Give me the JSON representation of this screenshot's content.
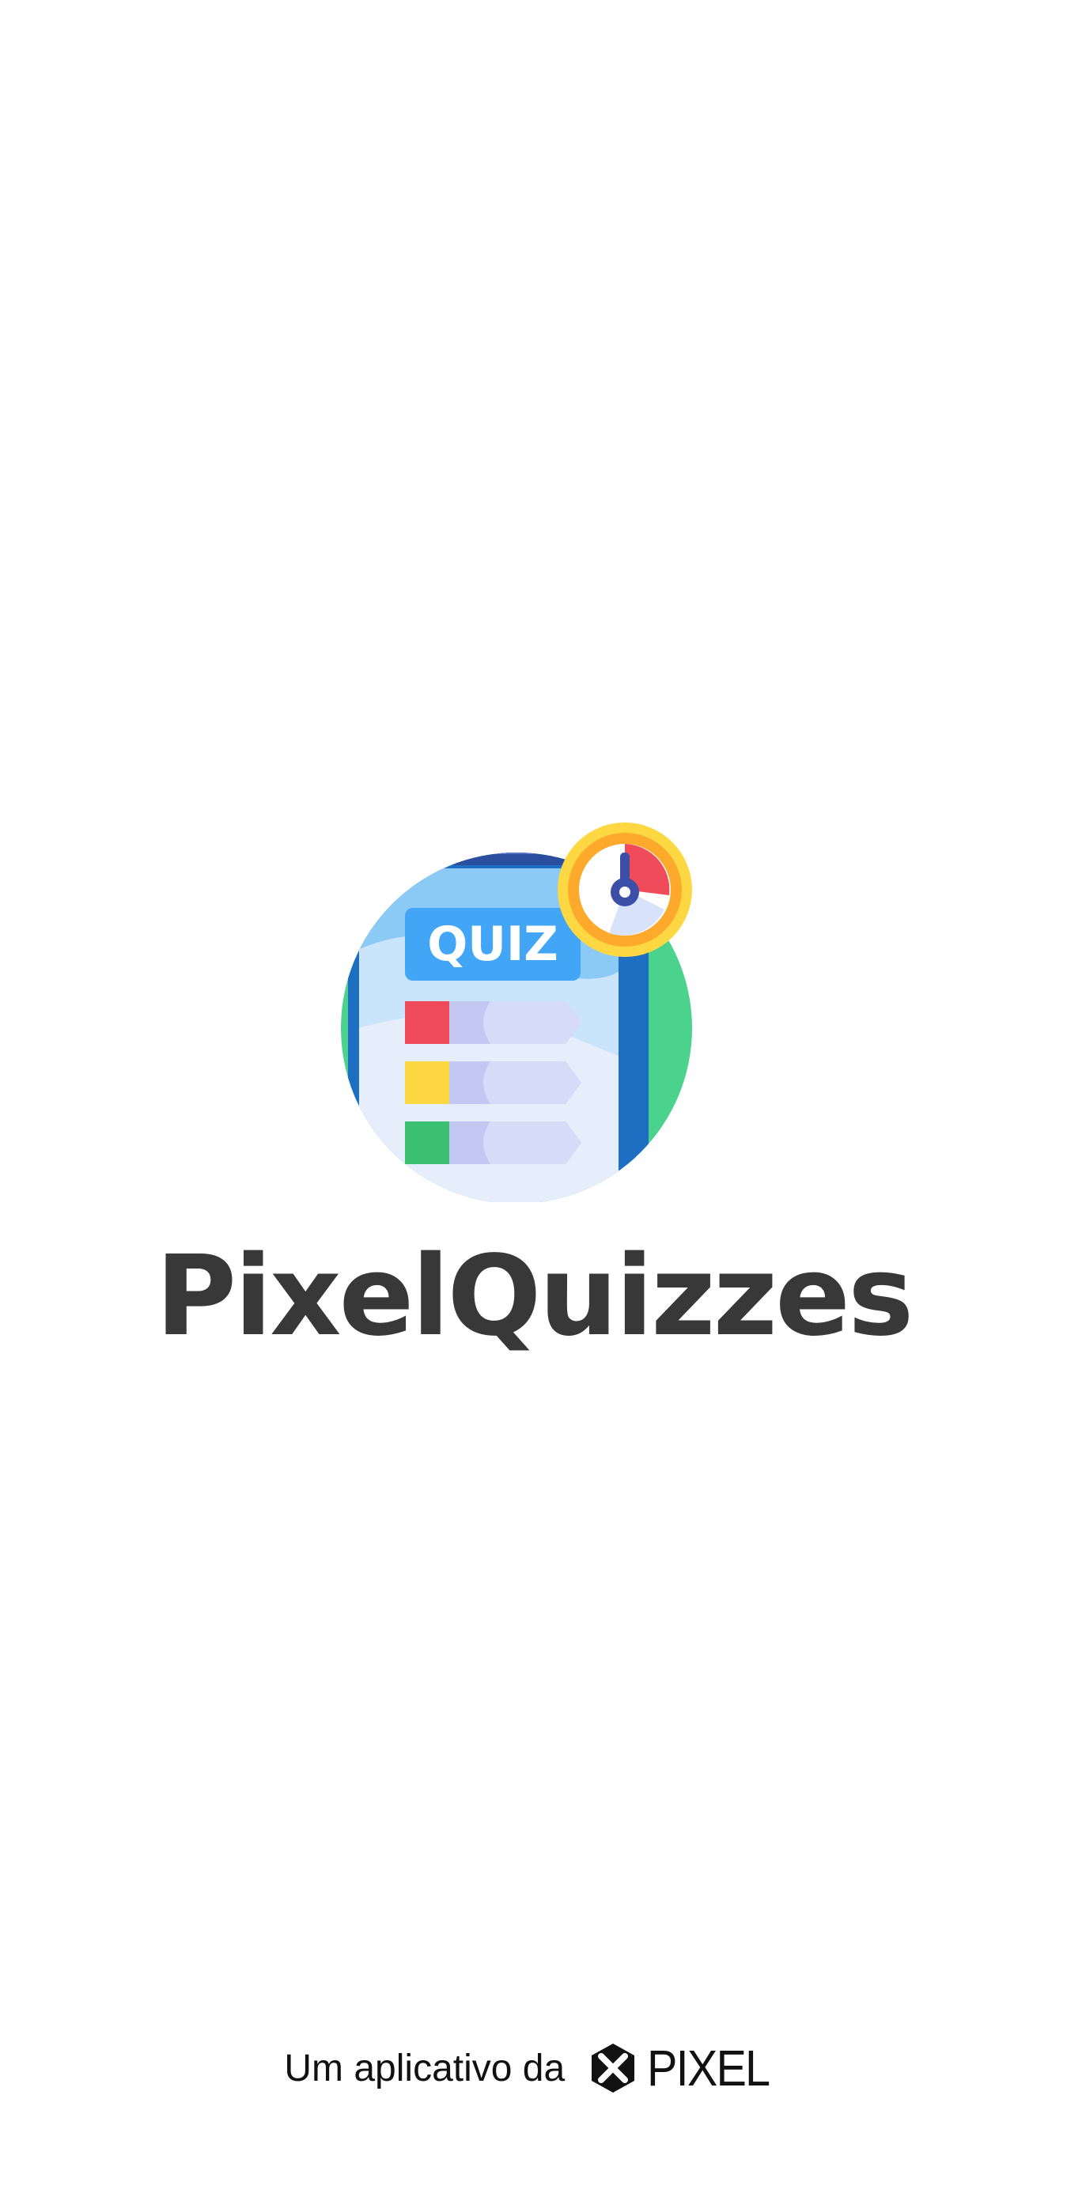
{
  "app": {
    "title": "PixelQuizzes",
    "logo_icon": "quiz-stopwatch-icon",
    "logo_badge_text": "QUIZ"
  },
  "footer": {
    "caption": "Um aplicativo da",
    "brand_icon": "pixel-brand-icon",
    "brand_name": "PIXEL"
  },
  "colors": {
    "background": "#ffffff",
    "title": "#383838",
    "circle": "#4bd38e",
    "screen_frame": "#1e6fc1",
    "quiz_badge": "#42a5f5",
    "answer_red": "#ef4b5a",
    "answer_yellow": "#fdd842",
    "answer_green": "#3bbf70",
    "stopwatch_ring": "#fdb92c"
  }
}
